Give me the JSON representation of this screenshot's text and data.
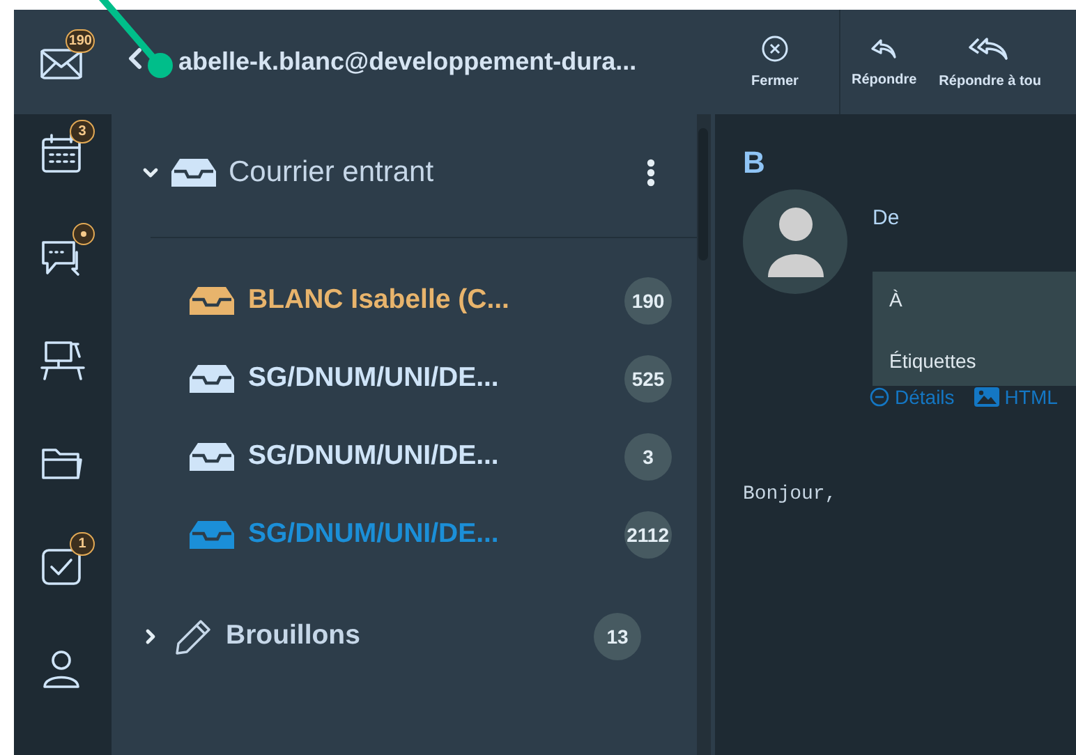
{
  "rail": [
    {
      "kind": "mail",
      "badge": "190",
      "dot": false
    },
    {
      "kind": "calendar",
      "badge": "3",
      "dot": false
    },
    {
      "kind": "chat",
      "dot": true
    },
    {
      "kind": "desk",
      "dot": false
    },
    {
      "kind": "folder",
      "dot": false
    },
    {
      "kind": "tasks",
      "badge": "1",
      "dot": false
    },
    {
      "kind": "contact",
      "dot": false
    }
  ],
  "account": {
    "title": "abelle-k.blanc@developpement-dura..."
  },
  "folders": [
    {
      "name": "Courrier entrant",
      "kind": "inbox",
      "expanded": true,
      "children": [
        {
          "name": "BLANC Isabelle (C...",
          "count": "190",
          "color": "#e8b46c"
        },
        {
          "name": "SG/DNUM/UNI/DE...",
          "count": "525",
          "color": "#cfe4f8"
        },
        {
          "name": "SG/DNUM/UNI/DE...",
          "count": "3",
          "color": "#cfe4f8"
        },
        {
          "name": "SG/DNUM/UNI/DE...",
          "count": "2112",
          "color": "#1b8fd8"
        }
      ]
    },
    {
      "name": "Brouillons",
      "kind": "drafts",
      "expanded": false,
      "count": "13"
    }
  ],
  "toolbar": [
    {
      "kind": "close",
      "label": "Fermer"
    },
    {
      "kind": "reply",
      "label": "Répondre"
    },
    {
      "kind": "reply_all",
      "label": "Répondre à tou"
    }
  ],
  "message": {
    "subject": "B",
    "from_label": "De",
    "to_label": "À",
    "tags_label": "Étiquettes",
    "links": [
      {
        "kind": "details",
        "label": "Détails"
      },
      {
        "kind": "html",
        "label": "HTML"
      }
    ],
    "body": "Bonjour,"
  }
}
